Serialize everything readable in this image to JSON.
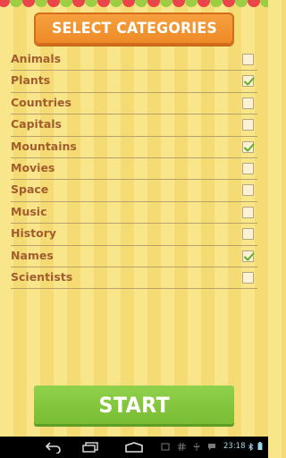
{
  "header": {
    "title": "SELECT CATEGORIES"
  },
  "categories": [
    {
      "label": "Animals",
      "checked": false
    },
    {
      "label": "Plants",
      "checked": true
    },
    {
      "label": "Countries",
      "checked": false
    },
    {
      "label": "Capitals",
      "checked": false
    },
    {
      "label": "Mountains",
      "checked": true
    },
    {
      "label": "Movies",
      "checked": false
    },
    {
      "label": "Space",
      "checked": false
    },
    {
      "label": "Music",
      "checked": false
    },
    {
      "label": "History",
      "checked": false
    },
    {
      "label": "Names",
      "checked": true
    },
    {
      "label": "Scientists",
      "checked": false
    }
  ],
  "start_button": {
    "label": "START"
  },
  "system_bar": {
    "time": "23:18",
    "icons": [
      "back-icon",
      "home-icon",
      "recent-apps-icon",
      "screenshot-icon",
      "hash-icon",
      "usb-icon",
      "chat-icon",
      "bluetooth-icon",
      "battery-icon"
    ]
  },
  "colors": {
    "stripe_light": "#f9e58a",
    "stripe_dark": "#f5db73",
    "title_button": "#ee8a28",
    "category_text": "#a15d2e",
    "start_button": "#7fc43a",
    "check_mark": "#5fae2a",
    "scallop": [
      "#e9454a",
      "#9ccd43",
      "#e9454a",
      "#9ccd43"
    ]
  }
}
